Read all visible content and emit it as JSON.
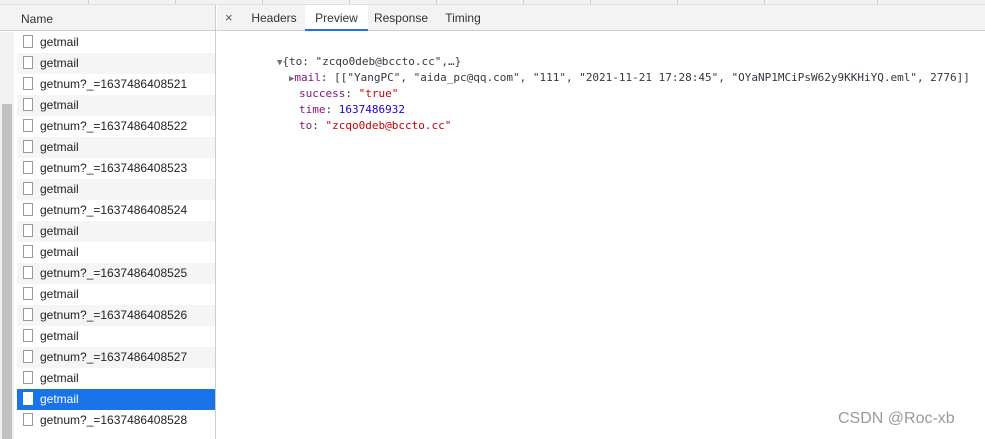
{
  "requests_panel": {
    "header": "Name",
    "rows": [
      {
        "label": "getmail"
      },
      {
        "label": "getmail"
      },
      {
        "label": "getnum?_=1637486408521"
      },
      {
        "label": "getmail"
      },
      {
        "label": "getnum?_=1637486408522"
      },
      {
        "label": "getmail"
      },
      {
        "label": "getnum?_=1637486408523"
      },
      {
        "label": "getmail"
      },
      {
        "label": "getnum?_=1637486408524"
      },
      {
        "label": "getmail"
      },
      {
        "label": "getmail"
      },
      {
        "label": "getnum?_=1637486408525"
      },
      {
        "label": "getmail"
      },
      {
        "label": "getnum?_=1637486408526"
      },
      {
        "label": "getmail"
      },
      {
        "label": "getnum?_=1637486408527"
      },
      {
        "label": "getmail"
      },
      {
        "label": "getmail",
        "selected": true
      },
      {
        "label": "getnum?_=1637486408528"
      }
    ]
  },
  "details": {
    "close_symbol": "×",
    "tabs": [
      "Headers",
      "Preview",
      "Response",
      "Timing"
    ],
    "active_tab": "Preview",
    "preview": {
      "root_summary": "{to: \"zcqo0deb@bccto.cc\",…}",
      "mail_key": "mail",
      "mail_value": "[[\"YangPC\", \"aida_pc@qq.com\", \"111\", \"2021-11-21 17:28:45\", \"OYaNP1MCiPsW62y9KKHiYQ.eml\", 2776]]",
      "success_key": "success",
      "success_value": "\"true\"",
      "time_key": "time",
      "time_value": "1637486932",
      "to_key": "to",
      "to_value": "\"zcqo0deb@bccto.cc\""
    }
  },
  "watermark": "CSDN @Roc-xb",
  "colors": {
    "selection": "#1a73e8",
    "json_key": "#881280",
    "json_string": "#c80000",
    "json_number": "#1c00cf"
  }
}
